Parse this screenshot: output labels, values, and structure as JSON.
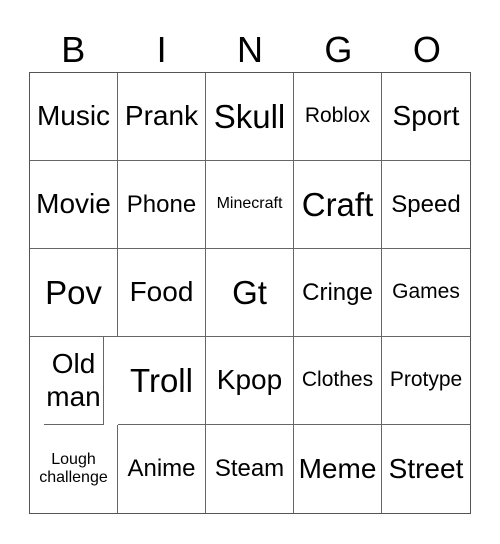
{
  "header": [
    "B",
    "I",
    "N",
    "G",
    "O"
  ],
  "cells": [
    {
      "text": "Music",
      "size": "large"
    },
    {
      "text": "Prank",
      "size": "large"
    },
    {
      "text": "Skull",
      "size": "xlarge"
    },
    {
      "text": "Roblox",
      "size": "medium"
    },
    {
      "text": "Sport",
      "size": "large"
    },
    {
      "text": "Movie",
      "size": "large"
    },
    {
      "text": "Phone",
      "size": "medium-large"
    },
    {
      "text": "Minecraft",
      "size": "small"
    },
    {
      "text": "Craft",
      "size": "xlarge"
    },
    {
      "text": "Speed",
      "size": "medium-large"
    },
    {
      "text": "Pov",
      "size": "xlarge"
    },
    {
      "text": "Food",
      "size": "large"
    },
    {
      "text": "Gt",
      "size": "xlarge"
    },
    {
      "text": "Cringe",
      "size": "medium-large"
    },
    {
      "text": "Games",
      "size": "medium"
    },
    {
      "text": "Old man",
      "size": "large"
    },
    {
      "text": "Troll",
      "size": "xlarge"
    },
    {
      "text": "Kpop",
      "size": "large"
    },
    {
      "text": "Clothes",
      "size": "medium"
    },
    {
      "text": "Protype",
      "size": "medium"
    },
    {
      "text": "Lough challenge",
      "size": "small"
    },
    {
      "text": "Anime",
      "size": "medium-large"
    },
    {
      "text": "Steam",
      "size": "medium-large"
    },
    {
      "text": "Meme",
      "size": "large"
    },
    {
      "text": "Street",
      "size": "large"
    }
  ]
}
